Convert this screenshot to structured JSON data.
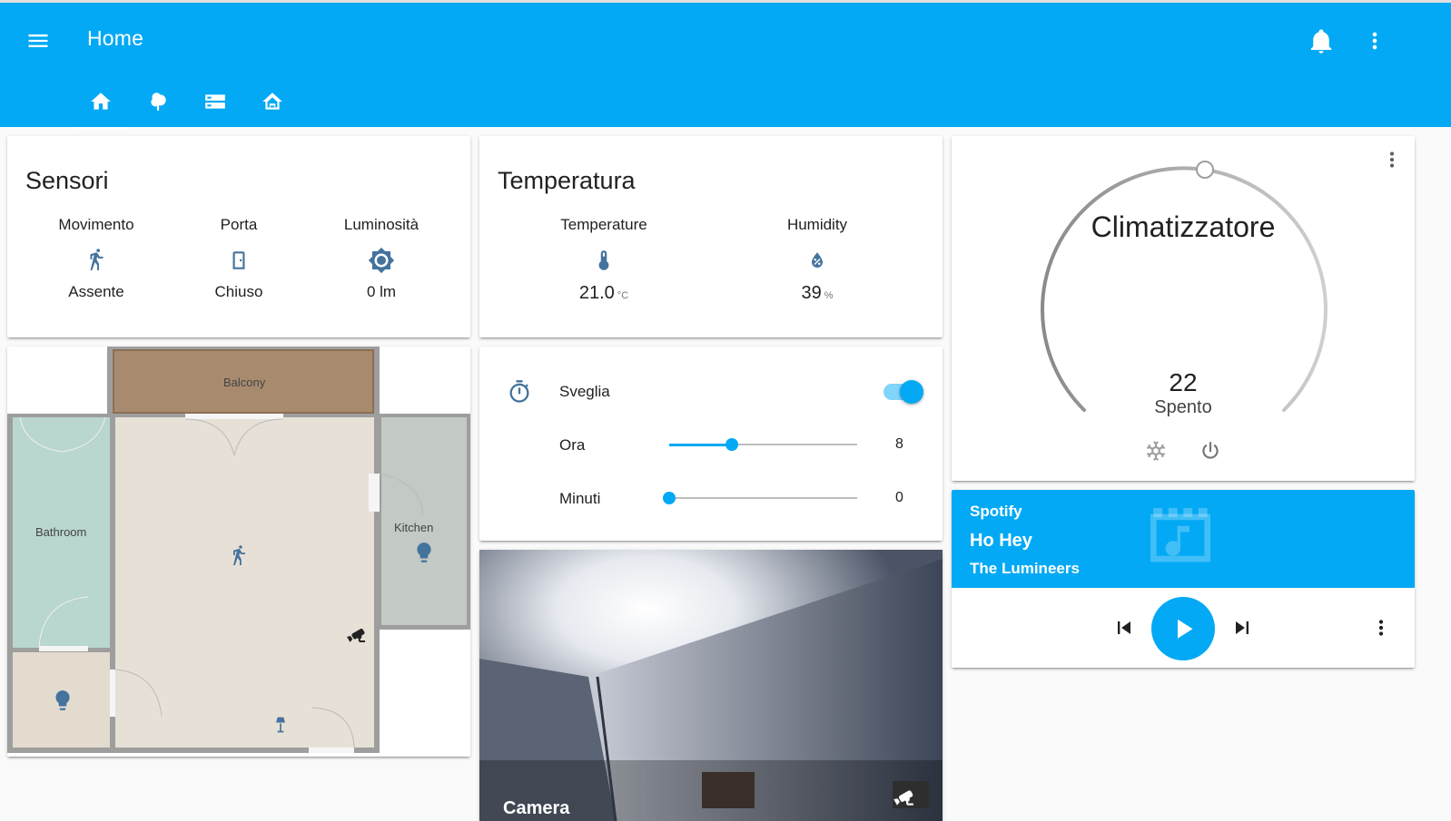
{
  "header": {
    "title": "Home",
    "tabs": [
      {
        "icon": "home-icon",
        "active": true
      },
      {
        "icon": "tree-icon",
        "active": false
      },
      {
        "icon": "server-icon",
        "active": false
      },
      {
        "icon": "home-outline-icon",
        "active": false
      }
    ]
  },
  "sensors": {
    "title": "Sensori",
    "items": [
      {
        "label": "Movimento",
        "icon": "walk-icon",
        "value": "Assente"
      },
      {
        "label": "Porta",
        "icon": "door-icon",
        "value": "Chiuso"
      },
      {
        "label": "Luminosità",
        "icon": "brightness-icon",
        "value": "0 lm"
      }
    ]
  },
  "temperature": {
    "title": "Temperatura",
    "items": [
      {
        "label": "Temperature",
        "icon": "thermometer-icon",
        "value": "21.0",
        "unit": "°C"
      },
      {
        "label": "Humidity",
        "icon": "water-percent-icon",
        "value": "39",
        "unit": "%"
      }
    ]
  },
  "floorplan": {
    "rooms": [
      "Balcony",
      "Bathroom",
      "Kitchen"
    ]
  },
  "alarm": {
    "label": "Sveglia",
    "enabled": true,
    "hour": {
      "label": "Ora",
      "value": "8",
      "fraction": 0.33
    },
    "minutes": {
      "label": "Minuti",
      "value": "0",
      "fraction": 0.0
    }
  },
  "camera": {
    "label": "Camera"
  },
  "climate": {
    "name": "Climatizzatore",
    "target": "22",
    "state": "Spento"
  },
  "media": {
    "source": "Spotify",
    "title": "Ho Hey",
    "artist": "The Lumineers"
  },
  "colors": {
    "primary": "#03a9f4",
    "icon": "#44739e"
  }
}
